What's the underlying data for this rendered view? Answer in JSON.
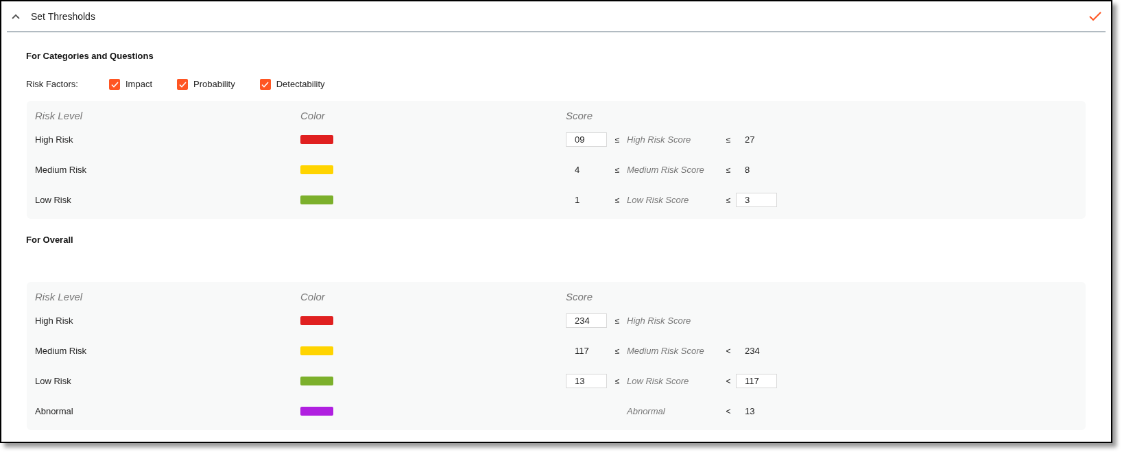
{
  "panel": {
    "title": "Set Thresholds",
    "expanded": true,
    "complete": true
  },
  "sections": [
    {
      "title": "For Categories and Questions",
      "risk_factors": {
        "label": "Risk Factors:",
        "options": [
          {
            "label": "Impact",
            "checked": true
          },
          {
            "label": "Probability",
            "checked": true
          },
          {
            "label": "Detectability",
            "checked": true
          }
        ]
      },
      "table": {
        "columns": [
          "Risk Level",
          "Color",
          "Score"
        ],
        "rows": [
          {
            "level": "High Risk",
            "color": "#e02020",
            "low": {
              "kind": "input",
              "value": "09"
            },
            "op1": "≤",
            "label": "High Risk Score",
            "op2": "≤",
            "high": {
              "kind": "text",
              "value": "27"
            }
          },
          {
            "level": "Medium Risk",
            "color": "#ffd400",
            "low": {
              "kind": "text",
              "value": "4"
            },
            "op1": "≤",
            "label": "Medium Risk Score",
            "op2": "≤",
            "high": {
              "kind": "text",
              "value": "8"
            }
          },
          {
            "level": "Low Risk",
            "color": "#7cb02c",
            "low": {
              "kind": "text",
              "value": "1"
            },
            "op1": "≤",
            "label": "Low Risk Score",
            "op2": "≤",
            "high": {
              "kind": "input",
              "value": "3"
            }
          }
        ]
      }
    },
    {
      "title": "For Overall",
      "table": {
        "columns": [
          "Risk Level",
          "Color",
          "Score"
        ],
        "rows": [
          {
            "level": "High Risk",
            "color": "#e02020",
            "low": {
              "kind": "input",
              "value": "234"
            },
            "op1": "≤",
            "label": "High Risk Score"
          },
          {
            "level": "Medium Risk",
            "color": "#ffd400",
            "low": {
              "kind": "text",
              "value": "117"
            },
            "op1": "≤",
            "label": "Medium Risk Score",
            "op2": "<",
            "high": {
              "kind": "text",
              "value": "234"
            }
          },
          {
            "level": "Low Risk",
            "color": "#7cb02c",
            "low": {
              "kind": "input",
              "value": "13"
            },
            "op1": "≤",
            "label": "Low Risk Score",
            "op2": "<",
            "high": {
              "kind": "input",
              "value": "117"
            }
          },
          {
            "level": "Abnormal",
            "color": "#b020e0",
            "label": "Abnormal",
            "op2": "<",
            "high": {
              "kind": "text",
              "value": "13"
            }
          }
        ]
      }
    }
  ]
}
